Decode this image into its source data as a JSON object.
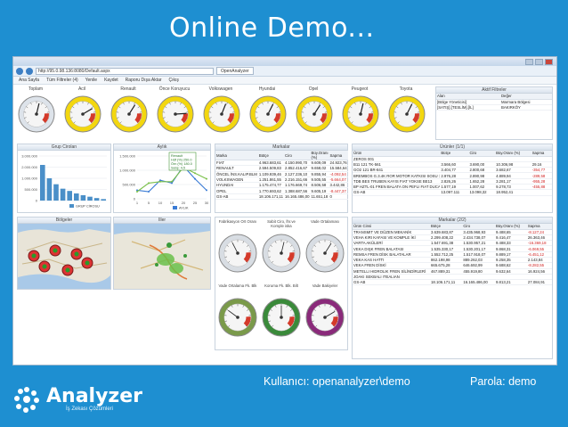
{
  "slide": {
    "title": "Online Demo...",
    "user_label": "Kullanıcı:   openanalyzer\\demo",
    "password_label": "Parola: demo",
    "logo_text": "Analyzer",
    "logo_tagline": "İş Zekası Çözümleri"
  },
  "browser": {
    "url": "http://95.0.98.136:8080/Default.aspx",
    "tab_label": "OpenAnalyzer",
    "menu": [
      "Ana Sayfa",
      "Tüm Filtreler (4)",
      "Yenile",
      "Kaydet",
      "Raporu Dışa Aktar",
      "Çıkış"
    ]
  },
  "gauges": [
    {
      "label": "Toplam",
      "value": 0.55,
      "color": "#dde3ea"
    },
    {
      "label": "Acil",
      "value": 0.72,
      "color": "#f3d70f"
    },
    {
      "label": "Renault",
      "value": 0.62,
      "color": "#f3d70f"
    },
    {
      "label": "Önce Koruyucu",
      "value": 0.82,
      "color": "#f3d70f"
    },
    {
      "label": "Volkswagen",
      "value": 0.58,
      "color": "#f3d70f"
    },
    {
      "label": "Hyundai",
      "value": 0.6,
      "color": "#f3d70f"
    },
    {
      "label": "Opel",
      "value": 0.62,
      "color": "#f3d70f"
    },
    {
      "label": "Peugeot",
      "value": 0.55,
      "color": "#f3d70f"
    },
    {
      "label": "Toyota",
      "value": 0.6,
      "color": "#f3d70f"
    }
  ],
  "active_filters": {
    "title": "Aktif Filtreler",
    "headers": [
      "Alan",
      "Değer"
    ],
    "rows": [
      [
        "[Bölge Yöneticisi]",
        "Marmara Bölgesi"
      ],
      [
        "[SATIŞ].[TESLİM].[İL]",
        "BAKIRKÖY"
      ]
    ]
  },
  "bar_panel": {
    "title": "Grup Ciroları",
    "legend": "GRUP CİROSU",
    "chart_data": {
      "type": "bar",
      "categories": [
        "1",
        "2",
        "3",
        "4",
        "5",
        "6",
        "7",
        "8",
        "9",
        "10"
      ],
      "values": [
        2400000,
        1500000,
        1100000,
        800000,
        650000,
        480000,
        360000,
        260000,
        170000,
        100000
      ],
      "ylabels": [
        "3.000.000",
        "2.000.000",
        "1.000.000",
        "500.000",
        "0"
      ]
    }
  },
  "line_panel": {
    "title": "Aylık",
    "tooltip": [
      "Renault",
      "Hdf (%) 250.0",
      "Örn (%) 180.0",
      "Satış: 4,5"
    ],
    "legend": "AYLIK",
    "chart_data": {
      "type": "line",
      "x": [
        "1",
        "5",
        "10",
        "15",
        "20",
        "25",
        "30"
      ],
      "ylabels": [
        "1.500.000",
        "1.000.000",
        "500.000",
        "0"
      ],
      "series": [
        {
          "values": [
            300000,
            250000,
            650000,
            550000,
            1150000,
            700000,
            300000
          ],
          "color": "#3a7bd5"
        },
        {
          "values": [
            250000,
            550000,
            600000,
            600000,
            1100000,
            900000,
            700000
          ],
          "color": "#7bc14a"
        }
      ]
    }
  },
  "markalar": {
    "title": "Markalar",
    "headers": [
      "Marka",
      "Bütçe",
      "Ciro",
      "Büy.Oranı (%)",
      "Sapma"
    ],
    "rows": [
      [
        "FIAT",
        "4.963.683,61",
        "4.150.990,70",
        "9.609,09",
        "24.923,76"
      ],
      [
        "RENAULT",
        "2.594.509,83",
        "2.852.416,67",
        "9.658,02",
        "15.584,64"
      ],
      [
        "ÖNCEL İNS.KALIP.BLM",
        "1.109.939,46",
        "2.127.236,10",
        "9.855,94",
        "-4.092,54"
      ],
      [
        "VOLKSWAGEN",
        "1.251.861,55",
        "2.216.151,66",
        "9.505,55",
        "-5.664,07"
      ],
      [
        "HYUNDAI",
        "1.175.474,77",
        "1.176.669,74",
        "8.506,58",
        "3.442,86"
      ],
      [
        "OPEL",
        "1.770.693,62",
        "1.388.687,56",
        "9.605,19",
        "-8.447,37"
      ],
      [
        "GS-AB",
        "18.106.171,11",
        "16.165.486,00",
        "11.651,18",
        "0"
      ]
    ]
  },
  "urunler": {
    "title": "Ürünler (1/1)",
    "headers": [
      "Ürün",
      "Bütçe",
      "Ciro",
      "Büy.Oranı (%)",
      "Sapma"
    ],
    "rows": [
      [
        "ZEROS 001",
        "",
        "",
        "",
        ""
      ],
      [
        "B11 121 TK-561",
        "3.566,60",
        "3.690,00",
        "10.306,98",
        "29.16"
      ],
      [
        "GO2 121 BR-841",
        "3.404,77",
        "2.800,68",
        "3.682,67",
        "-354,77"
      ],
      [
        "BREMBOS G.3.4K ROR MOTOR KATKISI SOSU 10 ADET",
        "2.976,28",
        "2.890,98",
        "4.889,94",
        "-289,58"
      ],
      [
        "TDB BES TRUBEN KAYIS FIAT YOKSE BE13",
        "2.826,26",
        "1.652,28",
        "3.281,17",
        "-955,28"
      ],
      [
        "BP HZTL-01 FREN BALATA ON PEFLI FIAT DUCATO 3.0MT / NBR/FT 06.01",
        "1.577,19",
        "1.007,62",
        "9.278,73",
        "-455,88"
      ],
      [
        "GS-AB",
        "13.097.111",
        "13.098,32",
        "18.952,41",
        ""
      ]
    ]
  },
  "mid_gauges": [
    {
      "label": "Fabrikasyon Ort Oranı",
      "value": 0.4,
      "ring": "#d8dde3"
    },
    {
      "label": "Sabit Ciro, İhr.ve Komple iska",
      "value": 0.55,
      "ring": "#d8dde3"
    },
    {
      "label": "Vade Ortalaması",
      "value": 0.62,
      "ring": "#d8dde3"
    },
    {
      "label": "Vade Ortalama Fk. Blk",
      "value": 0.3,
      "ring": "#7a9a4a"
    },
    {
      "label": "Koruma Fk. Blk. Bilt",
      "value": 0.5,
      "ring": "#3a8a3a"
    },
    {
      "label": "Vade Bakiyeler",
      "value": 0.72,
      "ring": "#8a2a7a"
    }
  ],
  "bottom_markalar": {
    "title": "Markalar (2/2)",
    "headers": [
      "Ürün Cinsi",
      "Bütçe",
      "Ciro",
      "Büy.Oranı (%)",
      "Sapma"
    ],
    "rows": [
      [
        "TRANSMIT VE DÜZEN MEKANİK",
        "3.639.683,87",
        "3.435.968,93",
        "9.488,65",
        "-8.127,24"
      ],
      [
        "VEHA KIRI KAFASI VE KOMPLE İKİ",
        "2.299.408,22",
        "2.434.738,07",
        "9.416,47",
        "26.363,46"
      ],
      [
        "VARTA AKÜLERİ",
        "1.547.691,38",
        "1.530.957,21",
        "9.488,33",
        "-16.369,18"
      ],
      [
        "VEKA DIŞK FREN BALATASI",
        "1.535.330,17",
        "1.530.201,17",
        "9.868,31",
        "-6.069,55"
      ],
      [
        "REMSA FREN DİSK BALATALAR",
        "1.552.712,25",
        "1.517.918,07",
        "9.889,17",
        "-6.451,12"
      ],
      [
        "VEKA KAS HATTI",
        "862.198,98",
        "889.262,03",
        "9.258,35",
        "2.143,84"
      ],
      [
        "VEKA FREN DİSKİ",
        "665.675,28",
        "646.692,99",
        "9.688,62",
        "-8.282,55"
      ],
      [
        "METELLI HIDROLIK FREN SİLİNDİRLERİ",
        "467.889,31",
        "455.919,80",
        "9.632,64",
        "16.924,56"
      ],
      [
        "JOAKI SEKBALI ITEALIAN",
        "",
        "",
        "",
        ""
      ],
      [
        "GS-AB",
        "18.106.171,11",
        "16.165.486,00",
        "9.813,21",
        "27.084,91"
      ]
    ]
  },
  "maps": {
    "left_title": "Bölgeler",
    "right_title": "İller"
  }
}
